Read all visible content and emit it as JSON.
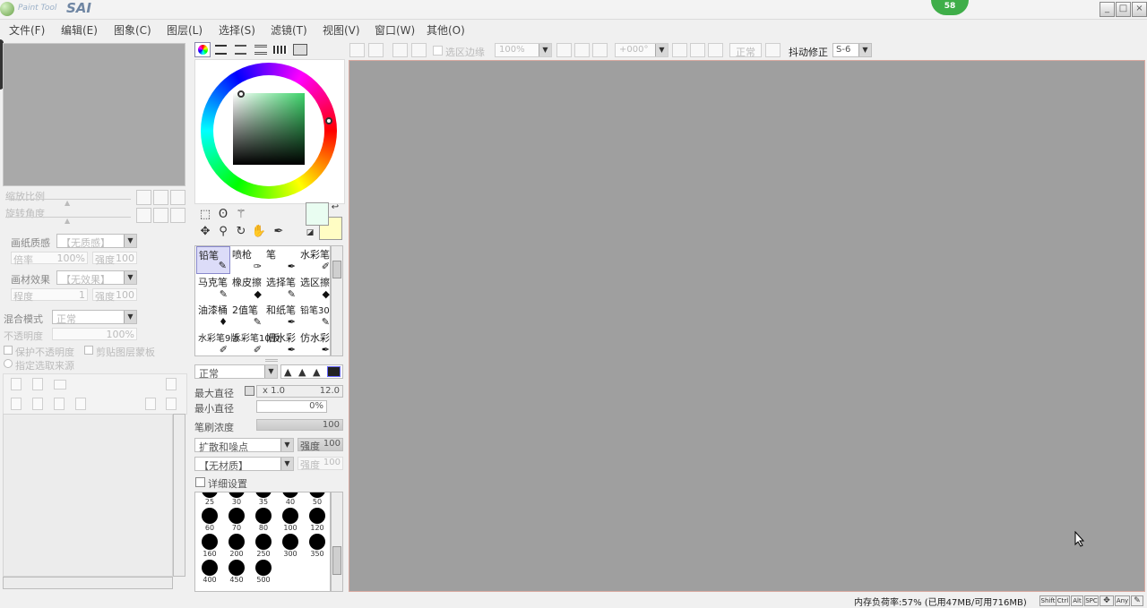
{
  "app": {
    "logo_small": "Paint Tool",
    "logo_big": "SAI",
    "badge": "58"
  },
  "window_buttons": [
    "_",
    "□",
    "×"
  ],
  "menu": [
    "文件(F)",
    "编辑(E)",
    "图象(C)",
    "图层(L)",
    "选择(S)",
    "滤镜(T)",
    "视图(V)",
    "窗口(W)",
    "其他(O)"
  ],
  "left_panel": {
    "zoom_label": "缩放比例",
    "angle_label": "旋转角度",
    "paper_texture_label": "画纸质感",
    "paper_texture_value": "【无质感】",
    "scale_label": "倍率",
    "scale_value": "100%",
    "strength_label": "强度",
    "strength_value": "100",
    "paper_effect_label": "画材效果",
    "paper_effect_value": "【无效果】",
    "degree_label": "程度",
    "degree_value": "1",
    "strength2_label": "强度",
    "strength2_value": "100",
    "blend_label": "混合模式",
    "blend_value": "正常",
    "opacity_label": "不透明度",
    "opacity_value": "100%",
    "protect_alpha": "保护不透明度",
    "clip_group": "剪贴图层蒙板",
    "selection_source": "指定选取来源"
  },
  "brush_tools": [
    {
      "label": "铅笔",
      "icon": "✎"
    },
    {
      "label": "喷枪",
      "icon": "✑"
    },
    {
      "label": "笔",
      "icon": "✒"
    },
    {
      "label": "水彩笔",
      "icon": "✐"
    },
    {
      "label": "马克笔",
      "icon": "✎"
    },
    {
      "label": "橡皮擦",
      "icon": "◆"
    },
    {
      "label": "选择笔",
      "icon": "✎"
    },
    {
      "label": "选区擦",
      "icon": "◆"
    },
    {
      "label": "油漆桶",
      "icon": "♦"
    },
    {
      "label": "2值笔",
      "icon": "✎"
    },
    {
      "label": "和纸笔",
      "icon": "✒"
    },
    {
      "label": "铅笔30",
      "icon": "✎"
    },
    {
      "label": "水彩笔9版",
      "icon": "✐"
    },
    {
      "label": "水彩笔10版",
      "icon": "✐"
    },
    {
      "label": "旧水彩",
      "icon": "✒"
    },
    {
      "label": "仿水彩",
      "icon": "✒"
    }
  ],
  "brush_settings": {
    "mode": "正常",
    "max_size_label": "最大直径",
    "max_size_mult": "x 1.0",
    "max_size_value": "12.0",
    "min_size_label": "最小直径",
    "min_size_value": "0%",
    "density_label": "笔刷浓度",
    "density_value": "100",
    "shape_value": "扩散和噪点",
    "shape_strength_label": "强度",
    "shape_strength_value": "100",
    "texture_value": "【无材质】",
    "texture_strength_label": "强度",
    "texture_strength_value": "100",
    "detail_label": "详细设置"
  },
  "brush_sizes": [
    "25",
    "30",
    "35",
    "40",
    "50",
    "60",
    "70",
    "80",
    "100",
    "120",
    "160",
    "200",
    "250",
    "300",
    "350",
    "400",
    "450",
    "500"
  ],
  "canvas_toolbar": {
    "select_edge": "选区边缘",
    "zoom": "100%",
    "angle": "+000°",
    "mode": "正常",
    "stabilizer_label": "抖动修正",
    "stabilizer_value": "S-6"
  },
  "status": {
    "memory": "内存负荷率:57% (已用47MB/可用716MB)",
    "keys": [
      "Shift",
      "Ctrl",
      "Alt",
      "SPC",
      "✥",
      "Any",
      "✎"
    ]
  },
  "colors": {
    "primary": "#e9fdf1",
    "secondary": "#fffdc4",
    "canvas": "#9f9f9f",
    "badge": "#3fae49"
  }
}
